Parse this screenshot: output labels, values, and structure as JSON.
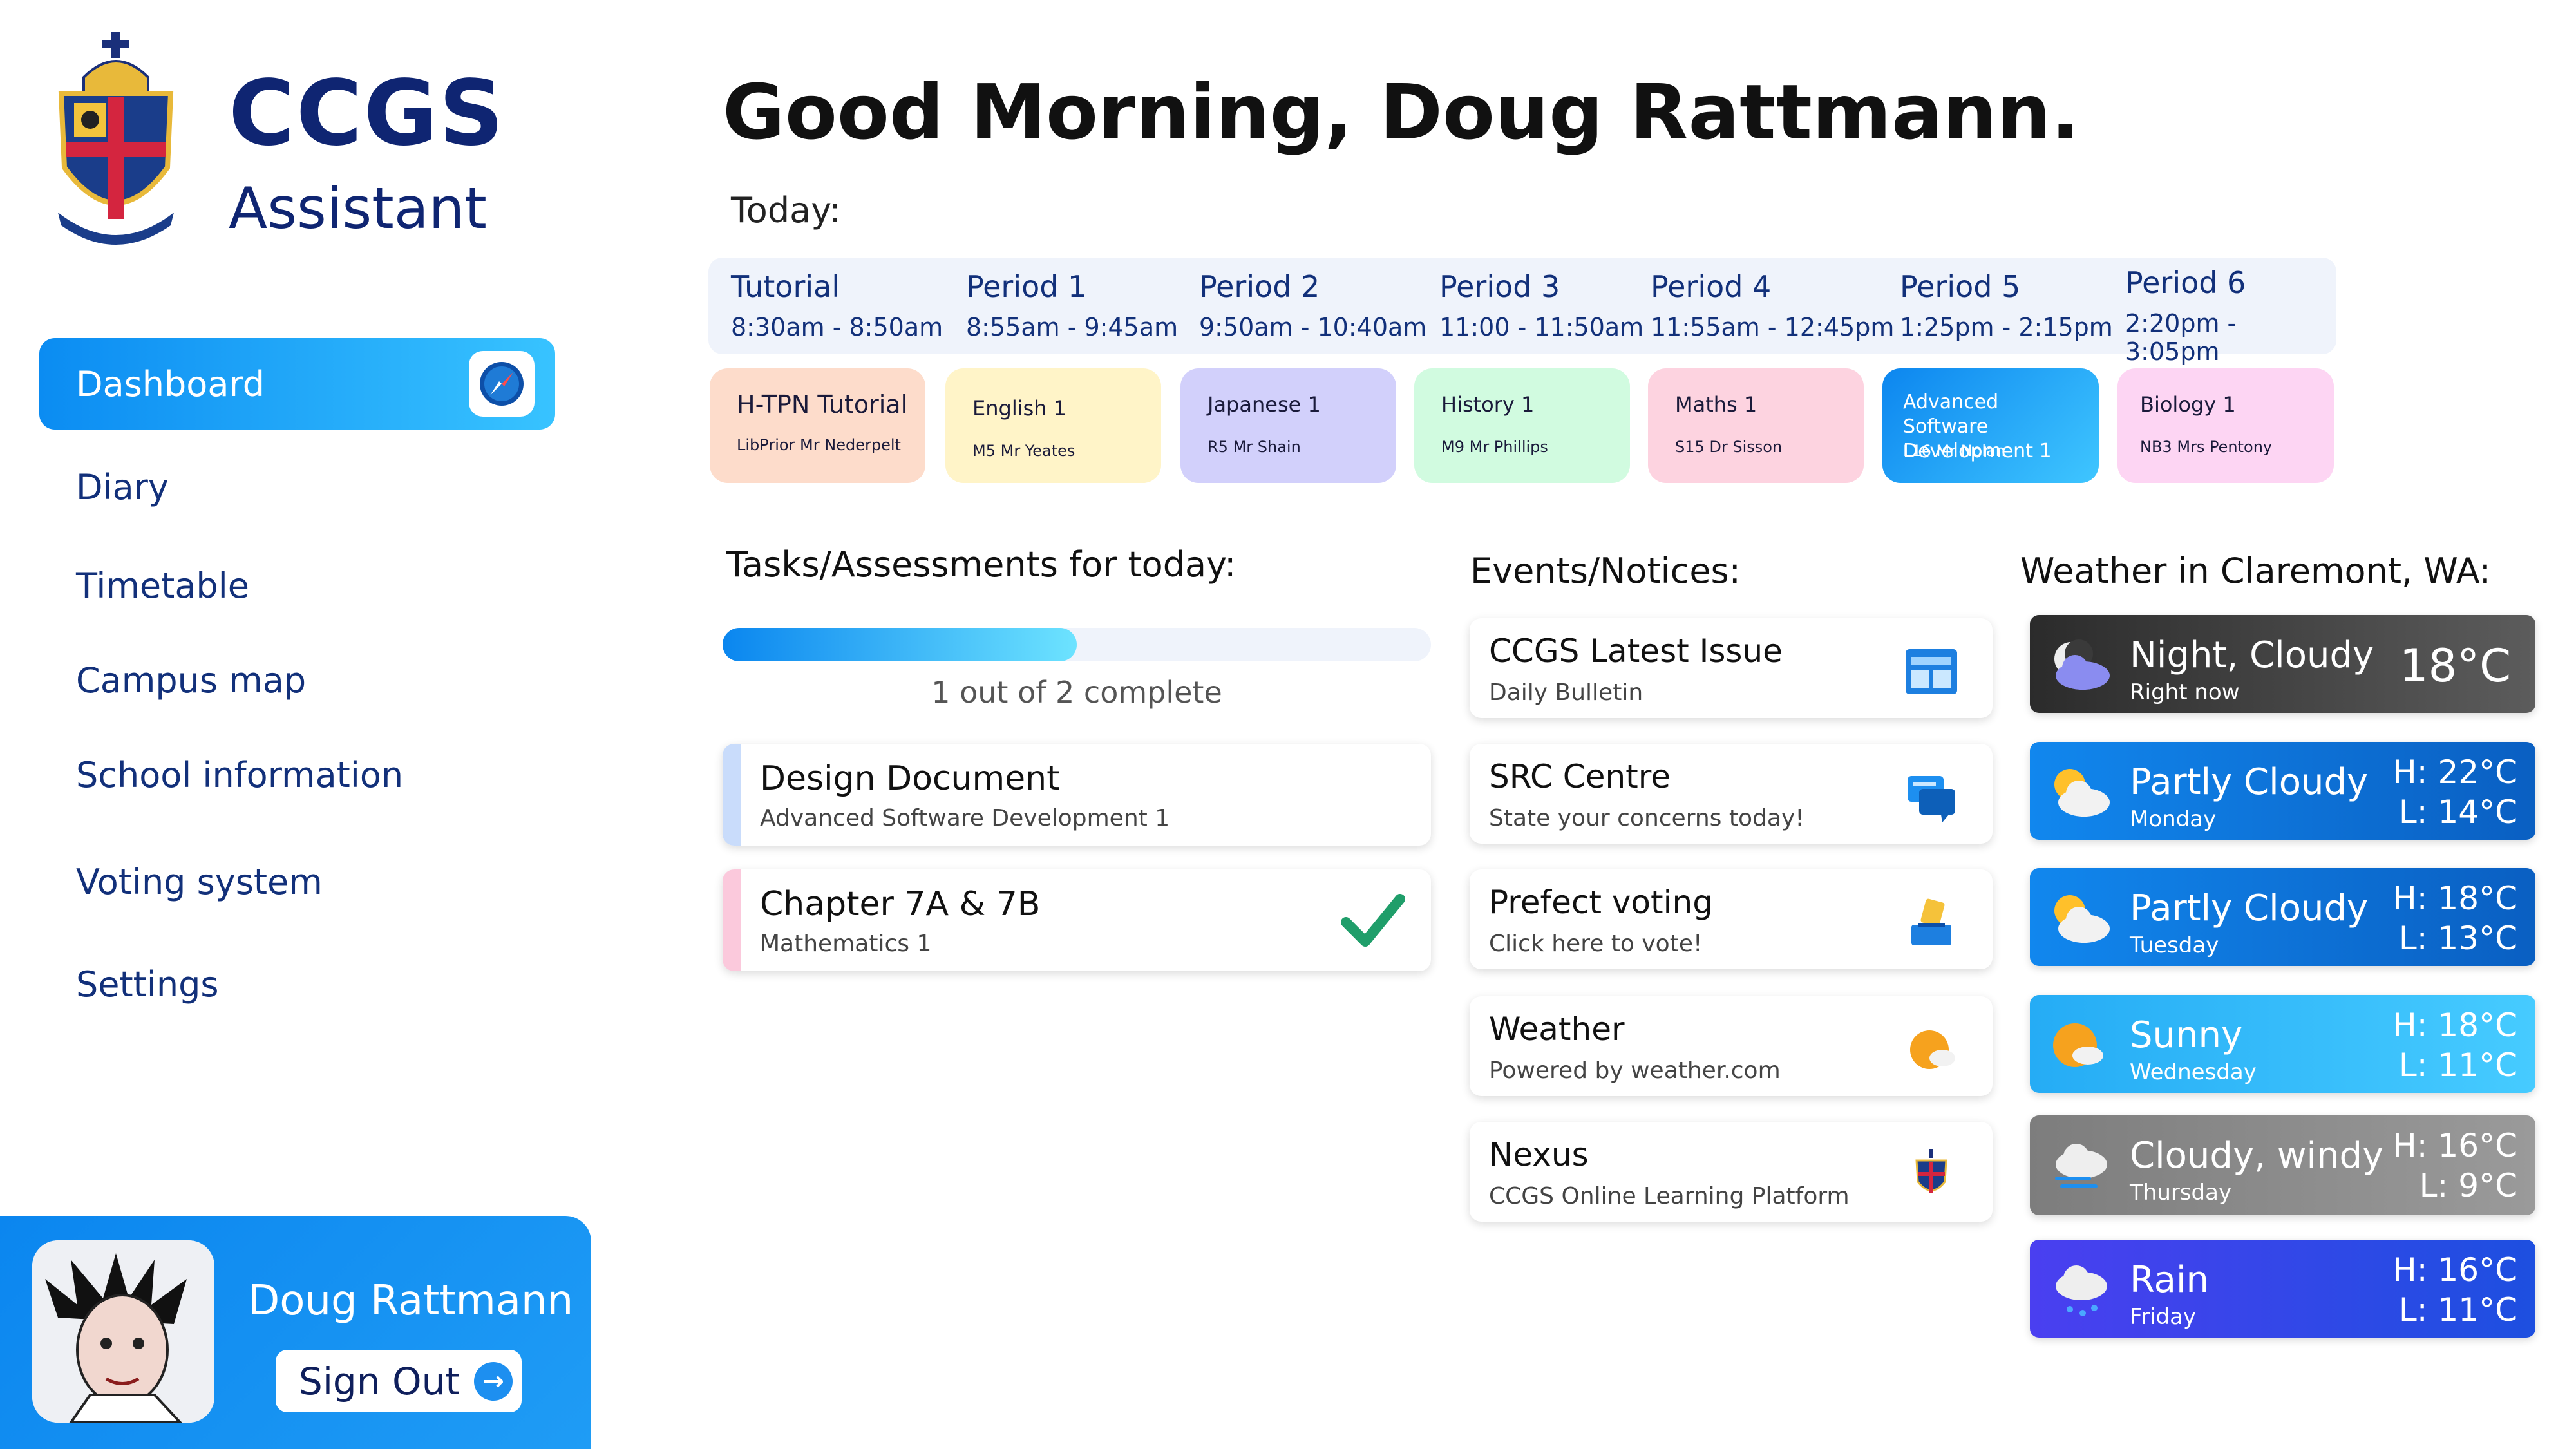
{
  "brand": {
    "title": "CCGS",
    "subtitle": "Assistant"
  },
  "nav": {
    "items": [
      {
        "label": "Dashboard",
        "active": true
      },
      {
        "label": "Diary"
      },
      {
        "label": "Timetable"
      },
      {
        "label": "Campus map"
      },
      {
        "label": "School information"
      },
      {
        "label": "Voting system"
      },
      {
        "label": "Settings"
      }
    ]
  },
  "user": {
    "name": "Doug Rattmann",
    "sign_out": "Sign Out"
  },
  "greeting": "Good Morning, Doug Rattmann.",
  "today_label": "Today:",
  "periods": [
    {
      "name": "Tutorial",
      "time": "8:30am - 8:50am"
    },
    {
      "name": "Period 1",
      "time": "8:55am - 9:45am"
    },
    {
      "name": "Period 2",
      "time": "9:50am - 10:40am"
    },
    {
      "name": "Period 3",
      "time": "11:00 - 11:50am"
    },
    {
      "name": "Period 4",
      "time": "11:55am - 12:45pm"
    },
    {
      "name": "Period 5",
      "time": "1:25pm - 2:15pm"
    },
    {
      "name": "Period 6",
      "time": "2:20pm - 3:05pm"
    }
  ],
  "classes": [
    {
      "name": "H-TPN Tutorial",
      "room": "LibPrior Mr Nederpelt",
      "color": "#fddccb"
    },
    {
      "name": "English 1",
      "room": "M5 Mr Yeates",
      "color": "#fff4c8"
    },
    {
      "name": "Japanese 1",
      "room": "R5 Mr Shain",
      "color": "#d2d0fb"
    },
    {
      "name": "History 1",
      "room": "M9 Mr Phillips",
      "color": "#d1fbe0"
    },
    {
      "name": "Maths 1",
      "room": "S15 Dr Sisson",
      "color": "#fdd3e0"
    },
    {
      "name": "Advanced Software Development 1",
      "room": "L16 Mr Nolan",
      "color": "#1796f0"
    },
    {
      "name": "Biology 1",
      "room": "NB3 Mrs Pentony",
      "color": "#fdd5f3"
    }
  ],
  "tasks": {
    "title": "Tasks/Assessments for today:",
    "progress_text": "1 out of 2 complete",
    "progress": 0.5,
    "items": [
      {
        "title": "Design Document",
        "subject": "Advanced Software Development 1",
        "accent": "#c9dcfb",
        "done": false
      },
      {
        "title": "Chapter 7A & 7B",
        "subject": "Mathematics 1",
        "accent": "#fbc9dc",
        "done": true
      }
    ]
  },
  "events": {
    "title": "Events/Notices:",
    "items": [
      {
        "title": "CCGS Latest Issue",
        "subtitle": "Daily Bulletin",
        "icon": "newspaper-icon"
      },
      {
        "title": "SRC Centre",
        "subtitle": "State your concerns today!",
        "icon": "chat-bubbles-icon"
      },
      {
        "title": "Prefect voting",
        "subtitle": "Click here to vote!",
        "icon": "ballot-box-icon"
      },
      {
        "title": "Weather",
        "subtitle": "Powered by weather.com",
        "icon": "sun-cloud-icon"
      },
      {
        "title": "Nexus",
        "subtitle": "CCGS Online Learning Platform",
        "icon": "school-crest-icon"
      }
    ]
  },
  "weather": {
    "title": "Weather in Claremont, WA:",
    "now": {
      "condition": "Night, Cloudy",
      "label": "Right now",
      "temp": "18°C",
      "icon": "moon-cloud-icon"
    },
    "days": [
      {
        "condition": "Partly Cloudy",
        "day": "Monday",
        "high": "H: 22°C",
        "low": "L: 14°C",
        "icon": "partly-cloudy-icon"
      },
      {
        "condition": "Partly Cloudy",
        "day": "Tuesday",
        "high": "H: 18°C",
        "low": "L: 13°C",
        "icon": "partly-cloudy-icon"
      },
      {
        "condition": "Sunny",
        "day": "Wednesday",
        "high": "H: 18°C",
        "low": "L: 11°C",
        "icon": "sunny-icon"
      },
      {
        "condition": "Cloudy, windy",
        "day": "Thursday",
        "high": "H: 16°C",
        "low": "L: 9°C",
        "icon": "cloud-wind-icon"
      },
      {
        "condition": "Rain",
        "day": "Friday",
        "high": "H: 16°C",
        "low": "L: 11°C",
        "icon": "rain-cloud-icon"
      }
    ]
  }
}
